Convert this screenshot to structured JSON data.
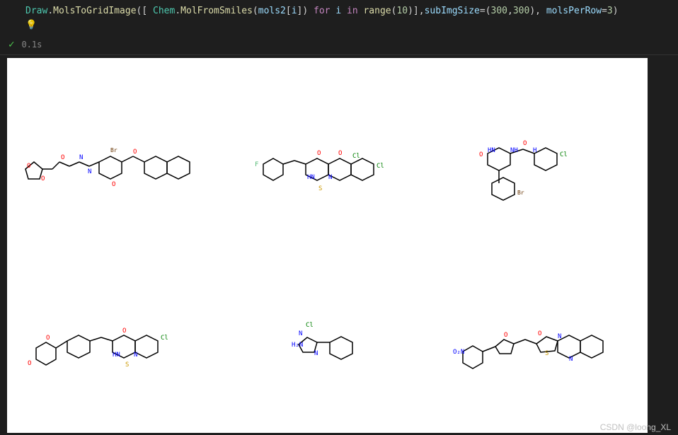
{
  "code": {
    "t1": "Draw",
    "t2": ".",
    "t3": "MolsToGridImage",
    "t4": "([ ",
    "t5": "Chem",
    "t6": ".",
    "t7": "MolFromSmiles",
    "t8": "(",
    "t9": "mols2",
    "t10": "[",
    "t11": "i",
    "t12": "]) ",
    "t13": "for",
    "t14": " ",
    "t15": "i",
    "t16": " ",
    "t17": "in",
    "t18": " ",
    "t19": "range",
    "t20": "(",
    "t21": "10",
    "t22": ")],",
    "t23": "subImgSize",
    "t24": "=(",
    "t25": "300",
    "t26": ",",
    "t27": "300",
    "t28": "), ",
    "t29": "molsPerRow",
    "t30": "=",
    "t31": "3",
    "t32": ")"
  },
  "status": {
    "time": "0.1s"
  },
  "watermark": "CSDN @loong_XL",
  "molecules": {
    "count": 6,
    "gridCols": 3,
    "subImgSize": [
      300,
      300
    ]
  }
}
